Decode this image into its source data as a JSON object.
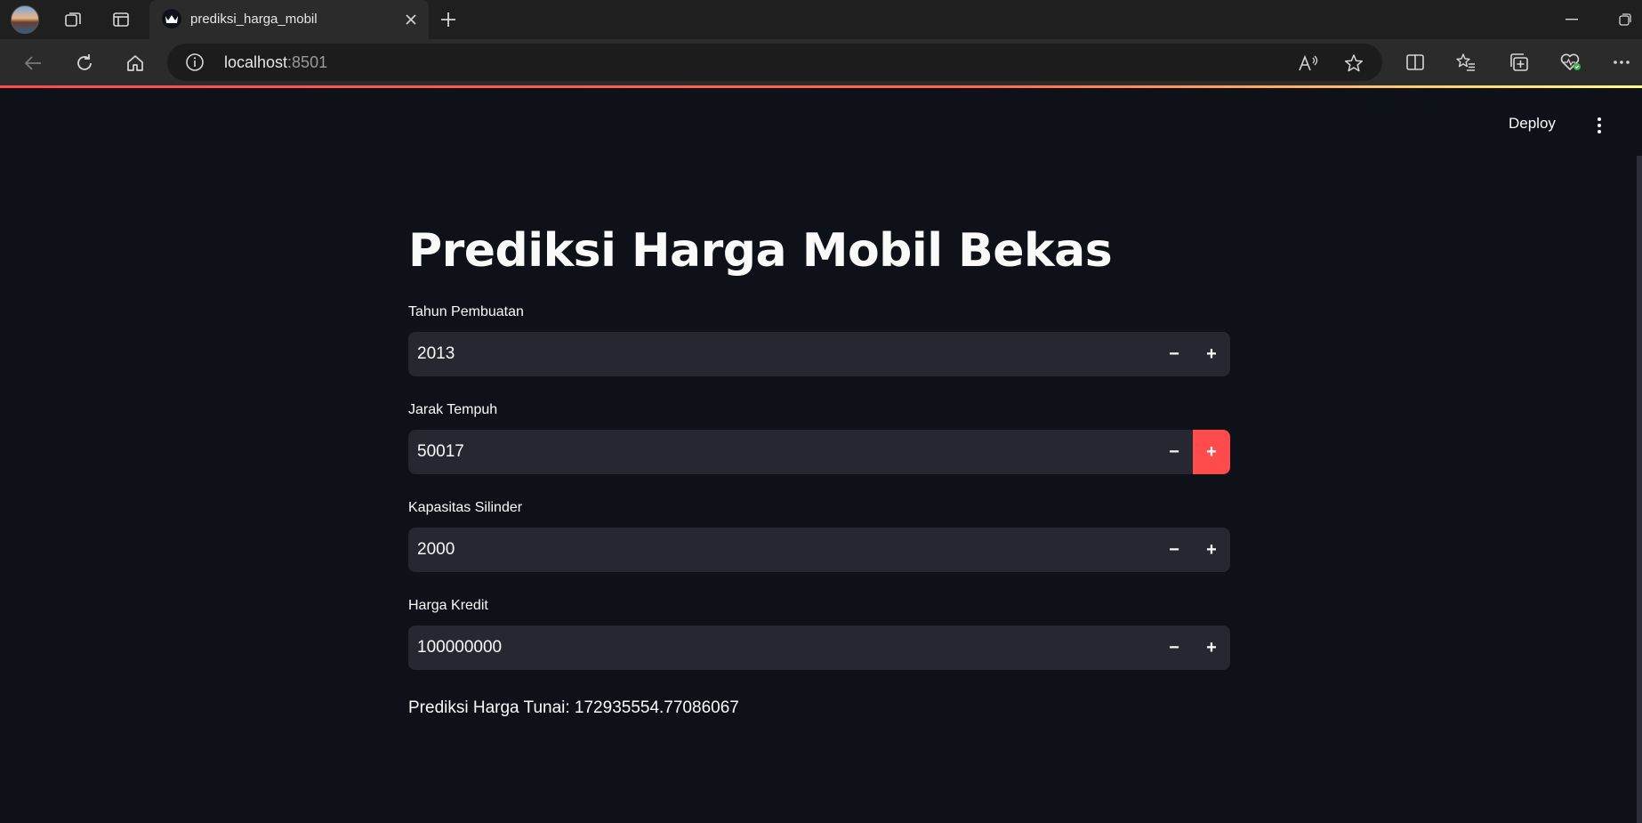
{
  "browser": {
    "tab_title": "prediksi_harga_mobil",
    "url_host": "localhost",
    "url_port": ":8501"
  },
  "header": {
    "deploy_label": "Deploy"
  },
  "app": {
    "title": "Prediksi Harga Mobil Bekas",
    "fields": [
      {
        "label": "Tahun Pembuatan",
        "value": "2013"
      },
      {
        "label": "Jarak Tempuh",
        "value": "50017"
      },
      {
        "label": "Kapasitas Silinder",
        "value": "2000"
      },
      {
        "label": "Harga Kredit",
        "value": "100000000"
      }
    ],
    "stepper": {
      "minus": "−",
      "plus": "+"
    },
    "result_label": "Prediksi Harga Tunai: ",
    "result_value": "172935554.77086067"
  },
  "colors": {
    "accent": "#ff4b4b",
    "background": "#0e1117",
    "input_bg": "#262730"
  },
  "icons": [
    "profile-avatar-icon",
    "workspaces-icon",
    "tab-actions-icon",
    "streamlit-crown-icon",
    "close-icon",
    "plus-icon",
    "back-icon",
    "refresh-icon",
    "home-icon",
    "info-icon",
    "read-aloud-icon",
    "favorite-star-icon",
    "split-screen-icon",
    "favorites-icon",
    "collections-icon",
    "browser-essentials-icon",
    "more-icon"
  ]
}
